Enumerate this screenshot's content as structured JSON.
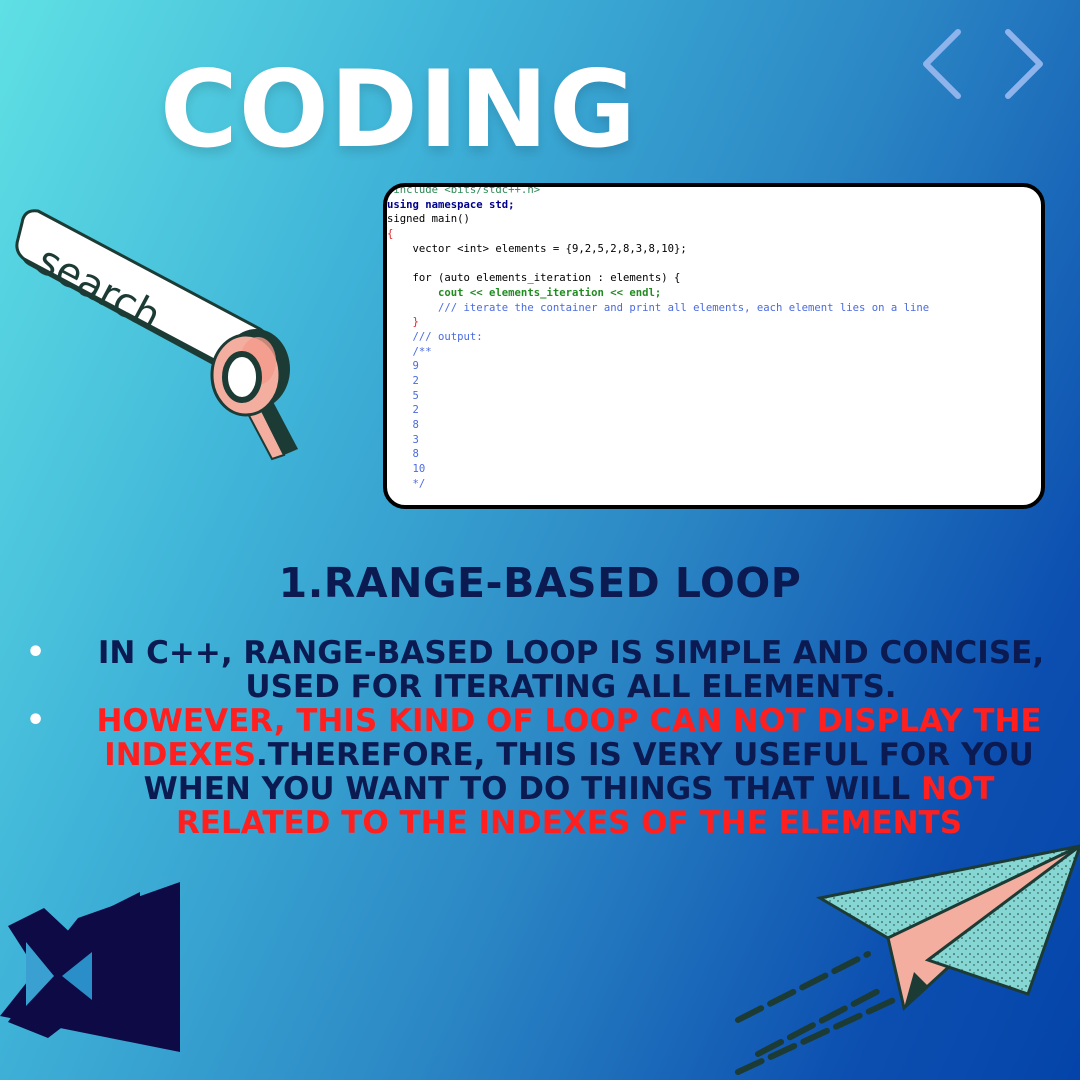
{
  "title": "CODING",
  "icons": {
    "nav_left": "chevron-left-icon",
    "nav_right": "chevron-right-icon",
    "search": "search-bar-illustration",
    "magnifier": "magnifying-glass-icon",
    "vs_logo": "visual-studio-logo",
    "plane": "paper-plane-illustration"
  },
  "search_label": "search",
  "code": {
    "lines": [
      "#include <bits/stdc++.h>",
      "using namespace std;",
      "signed main()",
      "{",
      "    vector <int> elements = {9,2,5,2,8,3,8,10};",
      "",
      "    for (auto elements_iteration : elements) {",
      "        cout << elements_iteration << endl;",
      "        /// iterate the container and print all elements, each element lies on a line",
      "    }",
      "    /// output:",
      "    /**",
      "    9",
      "    2",
      "    5",
      "    2",
      "    8",
      "    3",
      "    8",
      "    10",
      "    */"
    ]
  },
  "heading": "1.RANGE-BASED LOOP",
  "bullets": [
    {
      "bullet": "•",
      "text": "IN C++, RANGE-BASED LOOP IS SIMPLE AND CONCISE, USED FOR ITERATING ALL ELEMENTS."
    },
    {
      "bullet": "•",
      "red1": "HOWEVER, THIS KIND OF LOOP CAN NOT DISPLAY THE INDEXES",
      "mid": ".THEREFORE, THIS IS VERY USEFUL FOR YOU WHEN YOU WANT TO DO THINGS THAT WILL ",
      "red2": "NOT RELATED TO THE INDEXES OF THE ELEMENTS"
    }
  ],
  "colors": {
    "title": "#ffffff",
    "heading": "#0c1a52",
    "highlight": "#ff1f1f",
    "chevrons": "#8fb4ec",
    "vs_logo": "#0d0a45",
    "plane_teal": "#86d7d3",
    "plane_pink": "#f4aea0"
  }
}
